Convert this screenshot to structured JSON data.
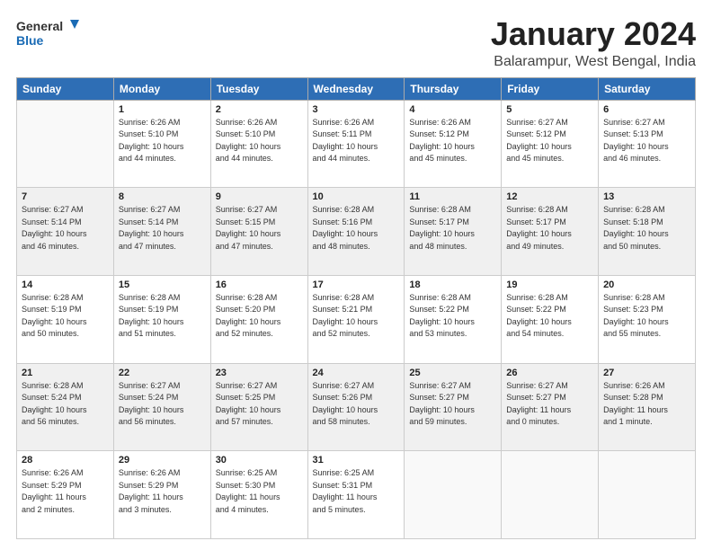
{
  "logo": {
    "line1": "General",
    "line2": "Blue"
  },
  "title": "January 2024",
  "location": "Balarampur, West Bengal, India",
  "days_of_week": [
    "Sunday",
    "Monday",
    "Tuesday",
    "Wednesday",
    "Thursday",
    "Friday",
    "Saturday"
  ],
  "weeks": [
    [
      {
        "day": "",
        "info": ""
      },
      {
        "day": "1",
        "info": "Sunrise: 6:26 AM\nSunset: 5:10 PM\nDaylight: 10 hours\nand 44 minutes."
      },
      {
        "day": "2",
        "info": "Sunrise: 6:26 AM\nSunset: 5:10 PM\nDaylight: 10 hours\nand 44 minutes."
      },
      {
        "day": "3",
        "info": "Sunrise: 6:26 AM\nSunset: 5:11 PM\nDaylight: 10 hours\nand 44 minutes."
      },
      {
        "day": "4",
        "info": "Sunrise: 6:26 AM\nSunset: 5:12 PM\nDaylight: 10 hours\nand 45 minutes."
      },
      {
        "day": "5",
        "info": "Sunrise: 6:27 AM\nSunset: 5:12 PM\nDaylight: 10 hours\nand 45 minutes."
      },
      {
        "day": "6",
        "info": "Sunrise: 6:27 AM\nSunset: 5:13 PM\nDaylight: 10 hours\nand 46 minutes."
      }
    ],
    [
      {
        "day": "7",
        "info": "Sunrise: 6:27 AM\nSunset: 5:14 PM\nDaylight: 10 hours\nand 46 minutes."
      },
      {
        "day": "8",
        "info": "Sunrise: 6:27 AM\nSunset: 5:14 PM\nDaylight: 10 hours\nand 47 minutes."
      },
      {
        "day": "9",
        "info": "Sunrise: 6:27 AM\nSunset: 5:15 PM\nDaylight: 10 hours\nand 47 minutes."
      },
      {
        "day": "10",
        "info": "Sunrise: 6:28 AM\nSunset: 5:16 PM\nDaylight: 10 hours\nand 48 minutes."
      },
      {
        "day": "11",
        "info": "Sunrise: 6:28 AM\nSunset: 5:17 PM\nDaylight: 10 hours\nand 48 minutes."
      },
      {
        "day": "12",
        "info": "Sunrise: 6:28 AM\nSunset: 5:17 PM\nDaylight: 10 hours\nand 49 minutes."
      },
      {
        "day": "13",
        "info": "Sunrise: 6:28 AM\nSunset: 5:18 PM\nDaylight: 10 hours\nand 50 minutes."
      }
    ],
    [
      {
        "day": "14",
        "info": "Sunrise: 6:28 AM\nSunset: 5:19 PM\nDaylight: 10 hours\nand 50 minutes."
      },
      {
        "day": "15",
        "info": "Sunrise: 6:28 AM\nSunset: 5:19 PM\nDaylight: 10 hours\nand 51 minutes."
      },
      {
        "day": "16",
        "info": "Sunrise: 6:28 AM\nSunset: 5:20 PM\nDaylight: 10 hours\nand 52 minutes."
      },
      {
        "day": "17",
        "info": "Sunrise: 6:28 AM\nSunset: 5:21 PM\nDaylight: 10 hours\nand 52 minutes."
      },
      {
        "day": "18",
        "info": "Sunrise: 6:28 AM\nSunset: 5:22 PM\nDaylight: 10 hours\nand 53 minutes."
      },
      {
        "day": "19",
        "info": "Sunrise: 6:28 AM\nSunset: 5:22 PM\nDaylight: 10 hours\nand 54 minutes."
      },
      {
        "day": "20",
        "info": "Sunrise: 6:28 AM\nSunset: 5:23 PM\nDaylight: 10 hours\nand 55 minutes."
      }
    ],
    [
      {
        "day": "21",
        "info": "Sunrise: 6:28 AM\nSunset: 5:24 PM\nDaylight: 10 hours\nand 56 minutes."
      },
      {
        "day": "22",
        "info": "Sunrise: 6:27 AM\nSunset: 5:24 PM\nDaylight: 10 hours\nand 56 minutes."
      },
      {
        "day": "23",
        "info": "Sunrise: 6:27 AM\nSunset: 5:25 PM\nDaylight: 10 hours\nand 57 minutes."
      },
      {
        "day": "24",
        "info": "Sunrise: 6:27 AM\nSunset: 5:26 PM\nDaylight: 10 hours\nand 58 minutes."
      },
      {
        "day": "25",
        "info": "Sunrise: 6:27 AM\nSunset: 5:27 PM\nDaylight: 10 hours\nand 59 minutes."
      },
      {
        "day": "26",
        "info": "Sunrise: 6:27 AM\nSunset: 5:27 PM\nDaylight: 11 hours\nand 0 minutes."
      },
      {
        "day": "27",
        "info": "Sunrise: 6:26 AM\nSunset: 5:28 PM\nDaylight: 11 hours\nand 1 minute."
      }
    ],
    [
      {
        "day": "28",
        "info": "Sunrise: 6:26 AM\nSunset: 5:29 PM\nDaylight: 11 hours\nand 2 minutes."
      },
      {
        "day": "29",
        "info": "Sunrise: 6:26 AM\nSunset: 5:29 PM\nDaylight: 11 hours\nand 3 minutes."
      },
      {
        "day": "30",
        "info": "Sunrise: 6:25 AM\nSunset: 5:30 PM\nDaylight: 11 hours\nand 4 minutes."
      },
      {
        "day": "31",
        "info": "Sunrise: 6:25 AM\nSunset: 5:31 PM\nDaylight: 11 hours\nand 5 minutes."
      },
      {
        "day": "",
        "info": ""
      },
      {
        "day": "",
        "info": ""
      },
      {
        "day": "",
        "info": ""
      }
    ]
  ]
}
